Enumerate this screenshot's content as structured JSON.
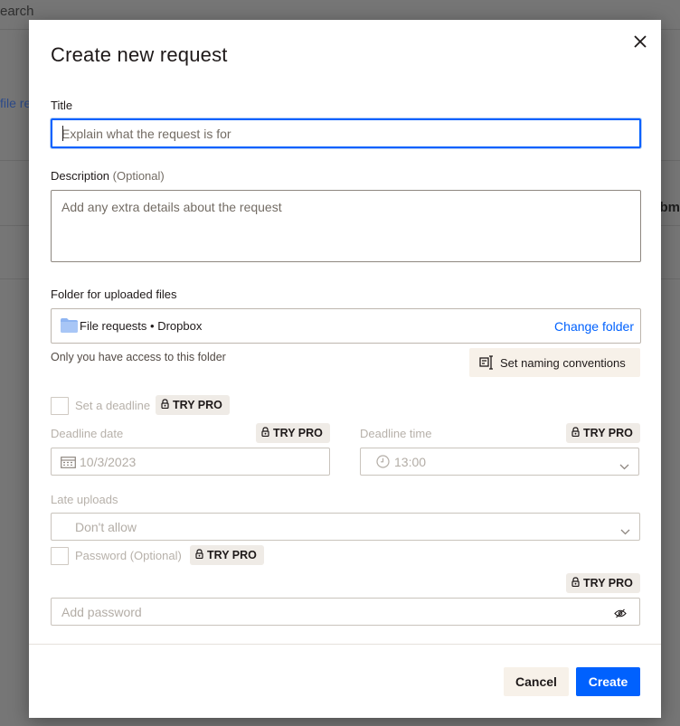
{
  "background": {
    "search_text": "earch",
    "link_text": "file re",
    "right_text": "bm"
  },
  "modal": {
    "title": "Create new request",
    "close_icon": "close-icon"
  },
  "title_field": {
    "label": "Title",
    "placeholder": "Explain what the request is for",
    "value": ""
  },
  "description_field": {
    "label": "Description",
    "optional": "(Optional)",
    "placeholder": "Add any extra details about the request"
  },
  "folder": {
    "label": "Folder for uploaded files",
    "path": "File requests • Dropbox",
    "change_label": "Change folder",
    "access_note": "Only you have access to this folder",
    "naming_label": "Set naming conventions"
  },
  "deadline": {
    "checkbox_label": "Set a deadline",
    "date_label": "Deadline date",
    "date_value": "10/3/2023",
    "time_label": "Deadline time",
    "time_value": "13:00"
  },
  "late_uploads": {
    "label": "Late uploads",
    "value": "Don't allow"
  },
  "password": {
    "checkbox_label": "Password",
    "optional": "(Optional)",
    "placeholder": "Add password"
  },
  "pro_badge": "TRY PRO",
  "footer": {
    "cancel_label": "Cancel",
    "create_label": "Create"
  },
  "colors": {
    "accent": "#0061fe",
    "secondary_button_bg": "#f7f1e9",
    "pro_badge_bg": "#efebe6"
  }
}
